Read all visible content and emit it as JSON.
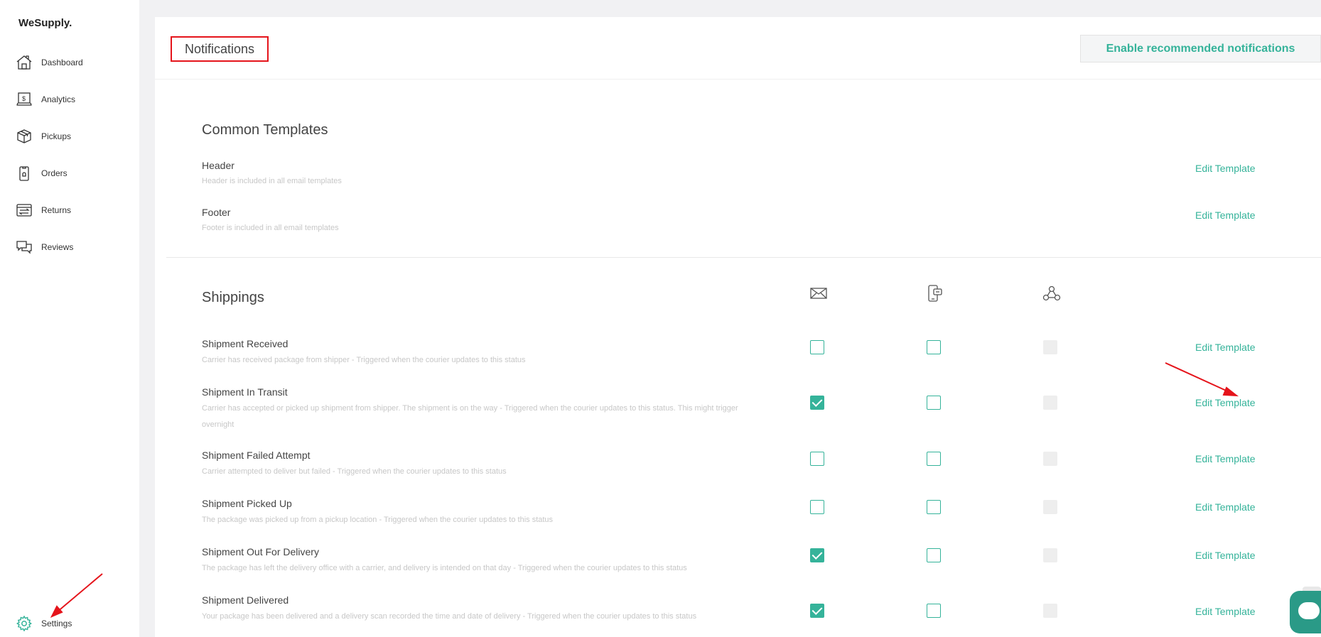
{
  "app": {
    "logo": "WeSupply."
  },
  "sidebar": {
    "items": [
      {
        "label": "Dashboard",
        "icon": "home-icon"
      },
      {
        "label": "Analytics",
        "icon": "analytics-icon"
      },
      {
        "label": "Pickups",
        "icon": "box-icon"
      },
      {
        "label": "Orders",
        "icon": "orders-icon"
      },
      {
        "label": "Returns",
        "icon": "returns-icon"
      },
      {
        "label": "Reviews",
        "icon": "reviews-icon"
      }
    ],
    "settings": {
      "label": "Settings",
      "icon": "gear-icon"
    }
  },
  "header": {
    "title": "Notifications",
    "enable_button": "Enable recommended notifications"
  },
  "common": {
    "title": "Common Templates",
    "rows": [
      {
        "title": "Header",
        "desc": "Header is included in all email templates",
        "action": "Edit Template"
      },
      {
        "title": "Footer",
        "desc": "Footer is included in all email templates",
        "action": "Edit Template"
      }
    ]
  },
  "shippings": {
    "title": "Shippings",
    "columns": [
      "email-icon",
      "sms-icon",
      "webhook-icon"
    ],
    "rows": [
      {
        "title": "Shipment Received",
        "desc": "Carrier has received package from shipper - Triggered when the courier updates to this status",
        "email": false,
        "sms": false,
        "webhook": "disabled",
        "action": "Edit Template"
      },
      {
        "title": "Shipment In Transit",
        "desc": "Carrier has accepted or picked up shipment from shipper. The shipment is on the way - Triggered when the courier updates to this status. This might trigger overnight",
        "email": true,
        "sms": false,
        "webhook": "disabled",
        "action": "Edit Template"
      },
      {
        "title": "Shipment Failed Attempt",
        "desc": "Carrier attempted to deliver but failed - Triggered when the courier updates to this status",
        "email": false,
        "sms": false,
        "webhook": "disabled",
        "action": "Edit Template"
      },
      {
        "title": "Shipment Picked Up",
        "desc": "The package was picked up from a pickup location - Triggered when the courier updates to this status",
        "email": false,
        "sms": false,
        "webhook": "disabled",
        "action": "Edit Template"
      },
      {
        "title": "Shipment Out For Delivery",
        "desc": "The package has left the delivery office with a carrier, and delivery is intended on that day - Triggered when the courier updates to this status",
        "email": true,
        "sms": false,
        "webhook": "disabled",
        "action": "Edit Template"
      },
      {
        "title": "Shipment Delivered",
        "desc": "Your package has been delivered and a delivery scan recorded the time and date of delivery - Triggered when the courier updates to this status",
        "email": true,
        "sms": false,
        "webhook": "disabled",
        "action": "Edit Template"
      }
    ]
  },
  "colors": {
    "accent": "#35b39a",
    "annotation": "#e5141b"
  }
}
